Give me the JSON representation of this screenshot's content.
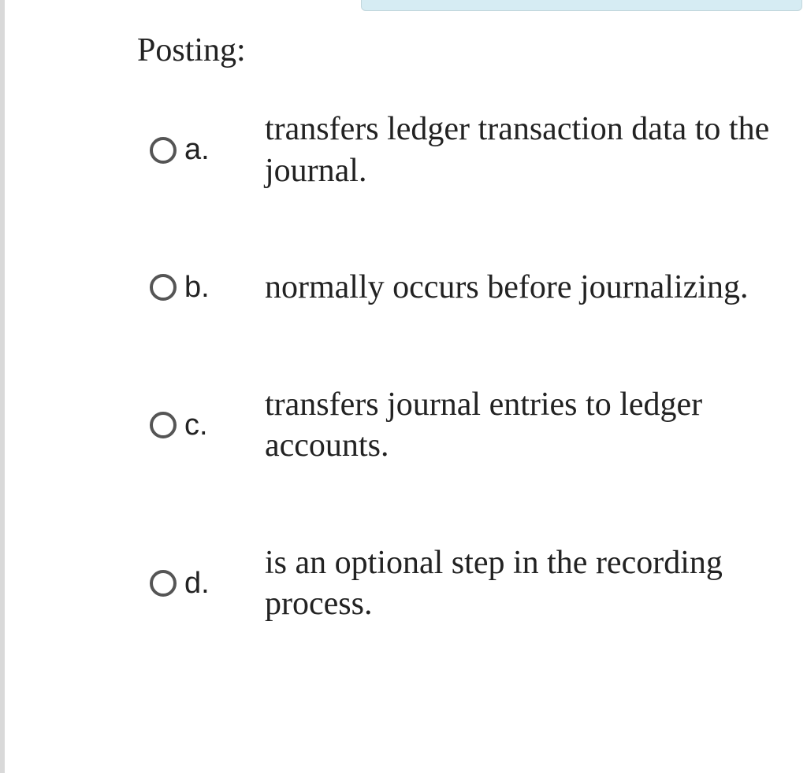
{
  "question": {
    "stem": "Posting:",
    "options": [
      {
        "letter": "a.",
        "text": "transfers ledger transaction data to the journal."
      },
      {
        "letter": "b.",
        "text": "normally occurs before journalizing."
      },
      {
        "letter": "c.",
        "text": "transfers journal entries to ledger accounts."
      },
      {
        "letter": "d.",
        "text": "is an optional step in the recording process."
      }
    ]
  }
}
